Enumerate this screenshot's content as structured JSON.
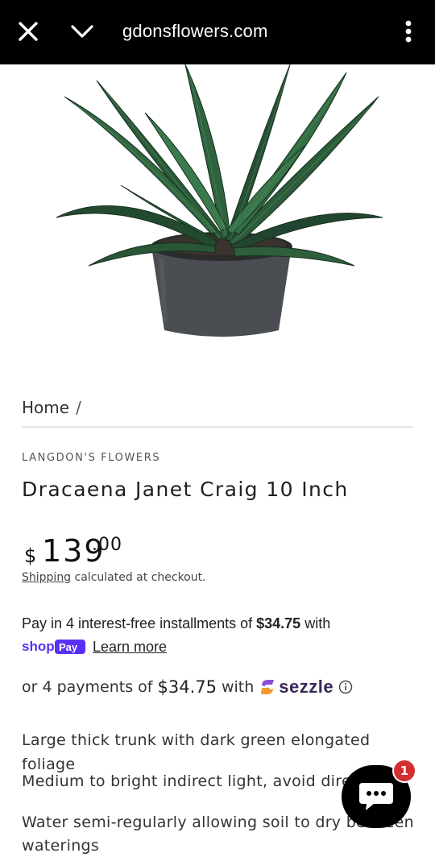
{
  "browser": {
    "url": "gdonsflowers.com"
  },
  "breadcrumb": {
    "home": "Home",
    "separator": "/"
  },
  "product": {
    "vendor": "LANGDON'S FLOWERS",
    "title": "Dracaena Janet Craig 10 Inch",
    "price": {
      "currency": "$",
      "main": "139",
      "cents": ".00"
    },
    "shipping_link": "Shipping",
    "shipping_text": "calculated at checkout."
  },
  "shop_pay": {
    "text_before": "Pay in 4 interest-free installments of ",
    "amount": "$34.75",
    "text_after": " with",
    "learn_more": "Learn more"
  },
  "sezzle": {
    "text_before": "or 4 payments of",
    "amount": "$34.75",
    "text_after": "with",
    "brand": "sezzle"
  },
  "description": [
    "Large thick trunk with dark green elongated foliage",
    "Medium to bright indirect light, avoid direct",
    "Water semi-regularly allowing soil to dry between",
    "waterings"
  ],
  "chat": {
    "badge_count": "1"
  },
  "colors": {
    "topbar": "#000000",
    "shop_pay_purple": "#5a31f4",
    "sezzle_purple": "#382757",
    "badge_red": "#d32f2f"
  }
}
